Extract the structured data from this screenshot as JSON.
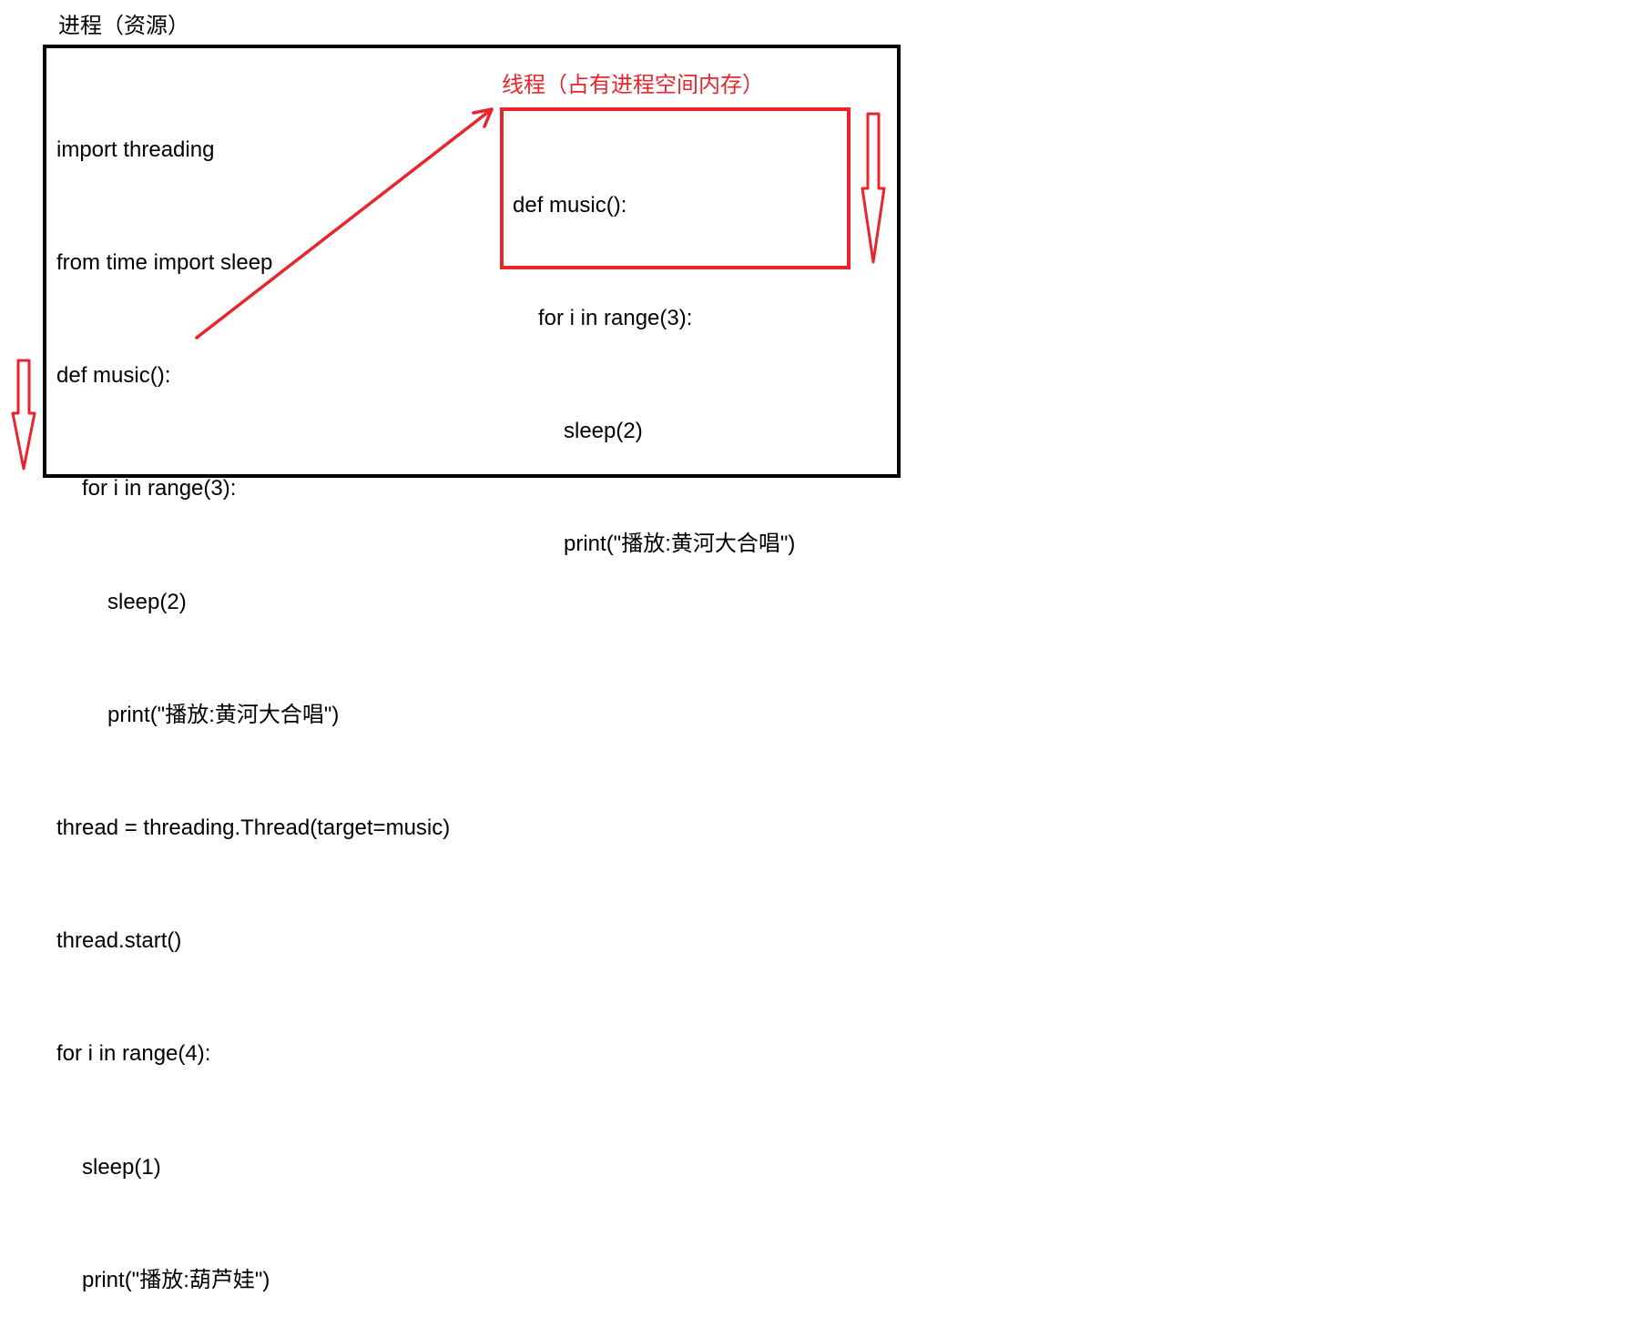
{
  "process_title": "进程（资源）",
  "main_code": {
    "lines": [
      "import threading",
      "from time import sleep",
      "def music():",
      "for i in range(3):",
      "sleep(2)",
      "print(\"播放:黄河大合唱\")",
      "thread = threading.Thread(target=music)",
      "thread.start()",
      "for i in range(4):",
      "sleep(1)",
      "print(\"播放:葫芦娃\")"
    ]
  },
  "thread_label": "线程（占有进程空间内存）",
  "thread_code": {
    "lines": [
      "def music():",
      "for i in range(3):",
      "sleep(2)",
      "print(\"播放:黄河大合唱\")"
    ]
  },
  "colors": {
    "text": "#000000",
    "process_border": "#000000",
    "accent": "#e8242c"
  },
  "icons": {
    "spawn_thread": "arrow-up-right-icon",
    "thread_flow": "arrow-down-icon",
    "main_flow": "arrow-down-icon"
  }
}
